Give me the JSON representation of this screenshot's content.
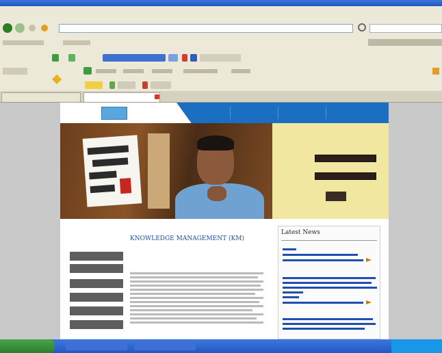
{
  "browser": {
    "menu": [
      "",
      "",
      "",
      "",
      "",
      ""
    ],
    "address": "",
    "tabs": [
      "",
      ""
    ]
  },
  "site": {
    "logo": "",
    "nav_links": [
      "",
      "",
      "",
      ""
    ],
    "login": {
      "title": "",
      "username_label": "",
      "password_label": "",
      "button": ""
    },
    "sidebar_menu": [
      "",
      "",
      "",
      "",
      "",
      ""
    ],
    "article": {
      "title": "KNOWLEDGE MANAGEMENT (KM)"
    },
    "news": {
      "title": "Latest News"
    }
  },
  "colors": {
    "nav_blue": "#1b6fc2",
    "login_bg": "#f1e7a0",
    "menu_gray": "#5e5e5e",
    "title_blue": "#1a4e9e"
  }
}
